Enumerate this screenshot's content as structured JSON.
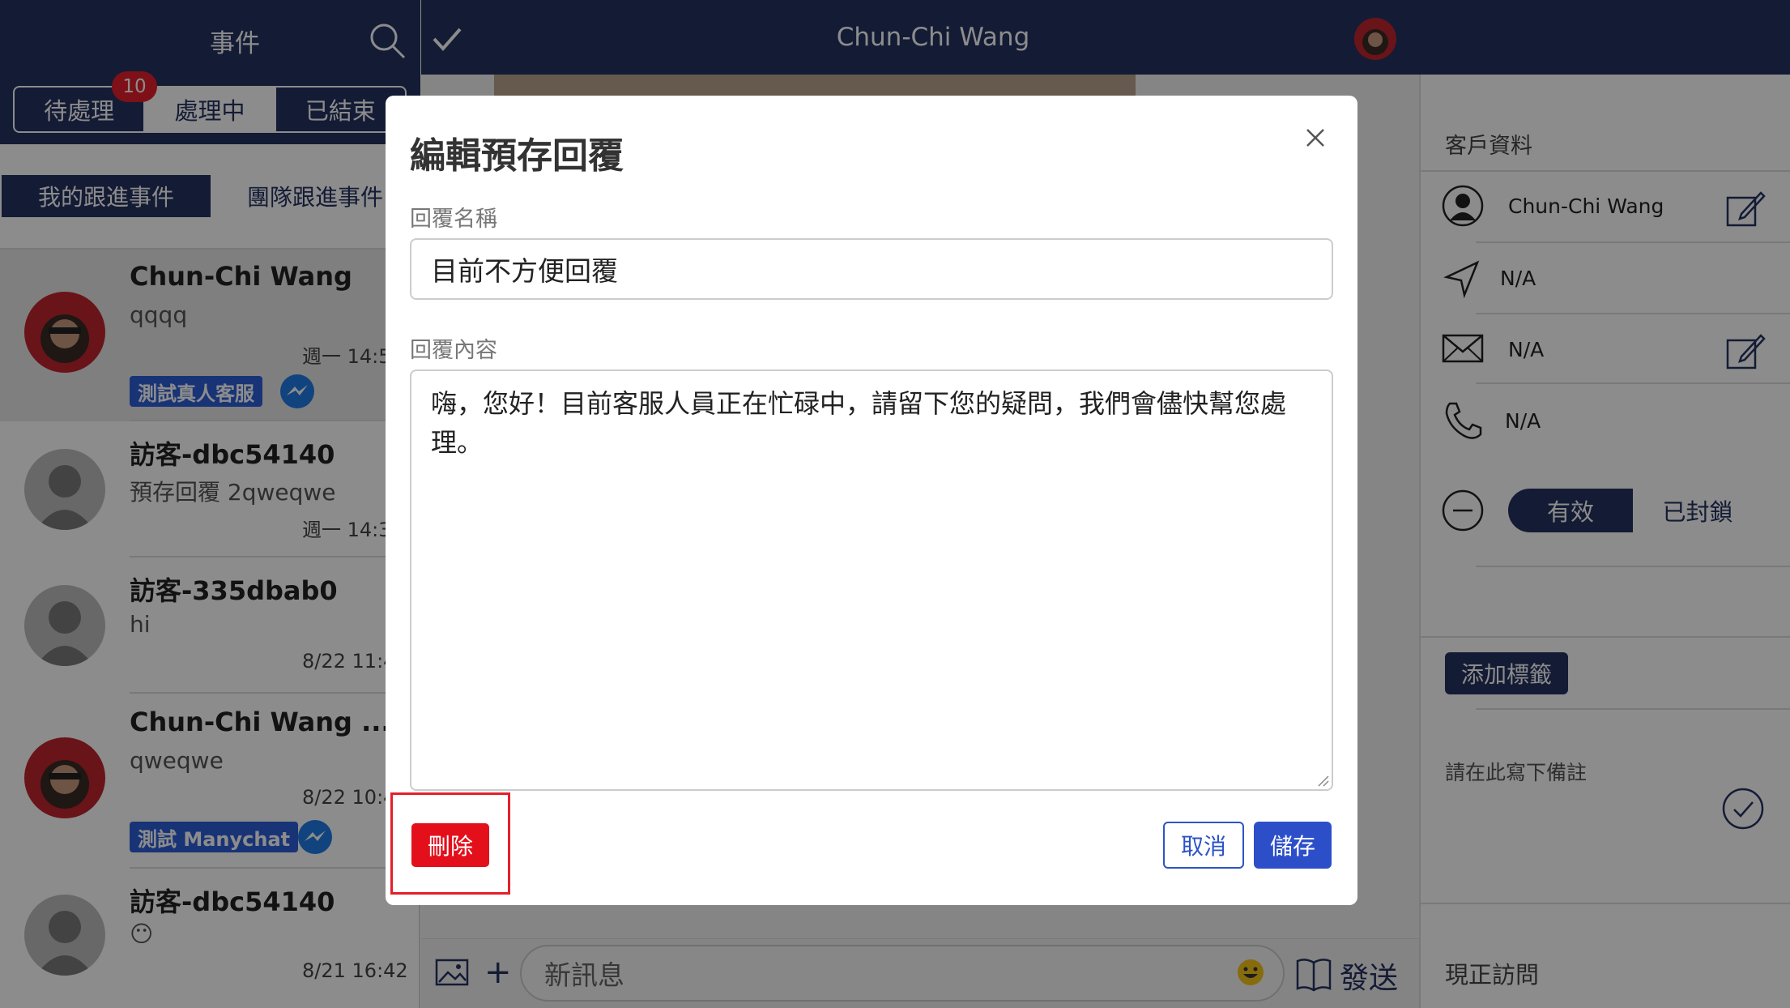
{
  "events_header": {
    "title": "事件"
  },
  "status_tabs": [
    {
      "label": "待處理",
      "badge": "10"
    },
    {
      "label": "處理中"
    },
    {
      "label": "已結束"
    }
  ],
  "follow_tabs": [
    {
      "label": "我的跟進事件"
    },
    {
      "label": "團隊跟進事件"
    }
  ],
  "conversations": [
    {
      "name": "Chun-Chi Wang",
      "message": "qqqq",
      "time": "週一 14:5",
      "tag": "測試真人客服"
    },
    {
      "name": "訪客-dbc54140",
      "message": "預存回覆 2qweqwe",
      "time": "週一 14:3"
    },
    {
      "name": "訪客-335dbab0",
      "message": "hi",
      "time": "8/22 11:4"
    },
    {
      "name": "Chun-Chi Wang ...",
      "message": "qweqwe",
      "time": "8/22 10:4",
      "tag": "測試 Manychat"
    },
    {
      "name": "訪客-dbc54140",
      "message": "😶",
      "time": "8/21 16:42"
    }
  ],
  "chat_header": {
    "title": "Chun-Chi Wang"
  },
  "composer": {
    "placeholder": "新訊息",
    "send_label": "發送"
  },
  "customer_panel": {
    "section_title": "客戶資料",
    "name": "Chun-Chi Wang",
    "location": "N/A",
    "email": "N/A",
    "phone": "N/A",
    "status_active": "有效",
    "status_blocked": "已封鎖",
    "add_tag_label": "添加標籤",
    "note_placeholder": "請在此寫下備註",
    "visiting_label": "現正訪問"
  },
  "modal": {
    "title": "編輯預存回覆",
    "name_label": "回覆名稱",
    "name_value": "目前不方便回覆",
    "content_label": "回覆內容",
    "content_value": "嗨，您好！目前客服人員正在忙碌中，請留下您的疑問，我們會儘快幫您處理。",
    "delete_label": "刪除",
    "cancel_label": "取消",
    "save_label": "儲存"
  },
  "colors": {
    "navy": "#253262",
    "danger": "#e3101c",
    "primary": "#2c4fc9"
  }
}
